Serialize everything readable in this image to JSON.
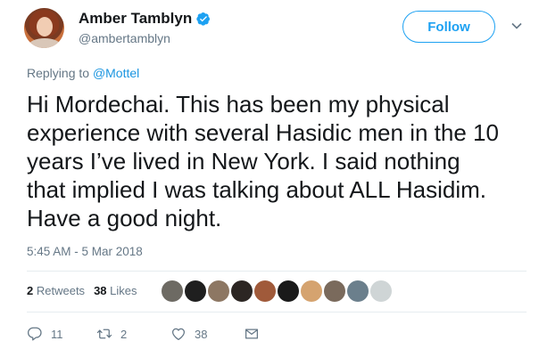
{
  "user": {
    "name": "Amber Tamblyn",
    "handle": "@ambertamblyn",
    "follow_label": "Follow"
  },
  "reply": {
    "prefix": "Replying to ",
    "mention": "@Mottel"
  },
  "tweet": {
    "lines": [
      "Hi Mordechai. This has been my physical",
      "experience with several Hasidic men in the 10",
      "years I’ve lived in New York. I said nothing",
      "that implied I was talking about ALL Hasidim.",
      "Have a good night."
    ],
    "timestamp": "5:45 AM - 5 Mar 2018"
  },
  "stats": {
    "retweets_count": "2",
    "retweets_label": "Retweets",
    "likes_count": "38",
    "likes_label": "Likes"
  },
  "likers": [
    {
      "color": "#6d6a63"
    },
    {
      "color": "#1f1f1f"
    },
    {
      "color": "#8d7763"
    },
    {
      "color": "#2c2623"
    },
    {
      "color": "#a05a3a"
    },
    {
      "color": "#1a1a1a"
    },
    {
      "color": "#d5a36f"
    },
    {
      "color": "#7a6a5c"
    },
    {
      "color": "#6b7f8c"
    },
    {
      "color": "#cfd5d6"
    }
  ],
  "actions": {
    "replies": "11",
    "retweets": "2",
    "likes": "38"
  },
  "colors": {
    "accent": "#1da1f2",
    "muted": "#657786"
  }
}
